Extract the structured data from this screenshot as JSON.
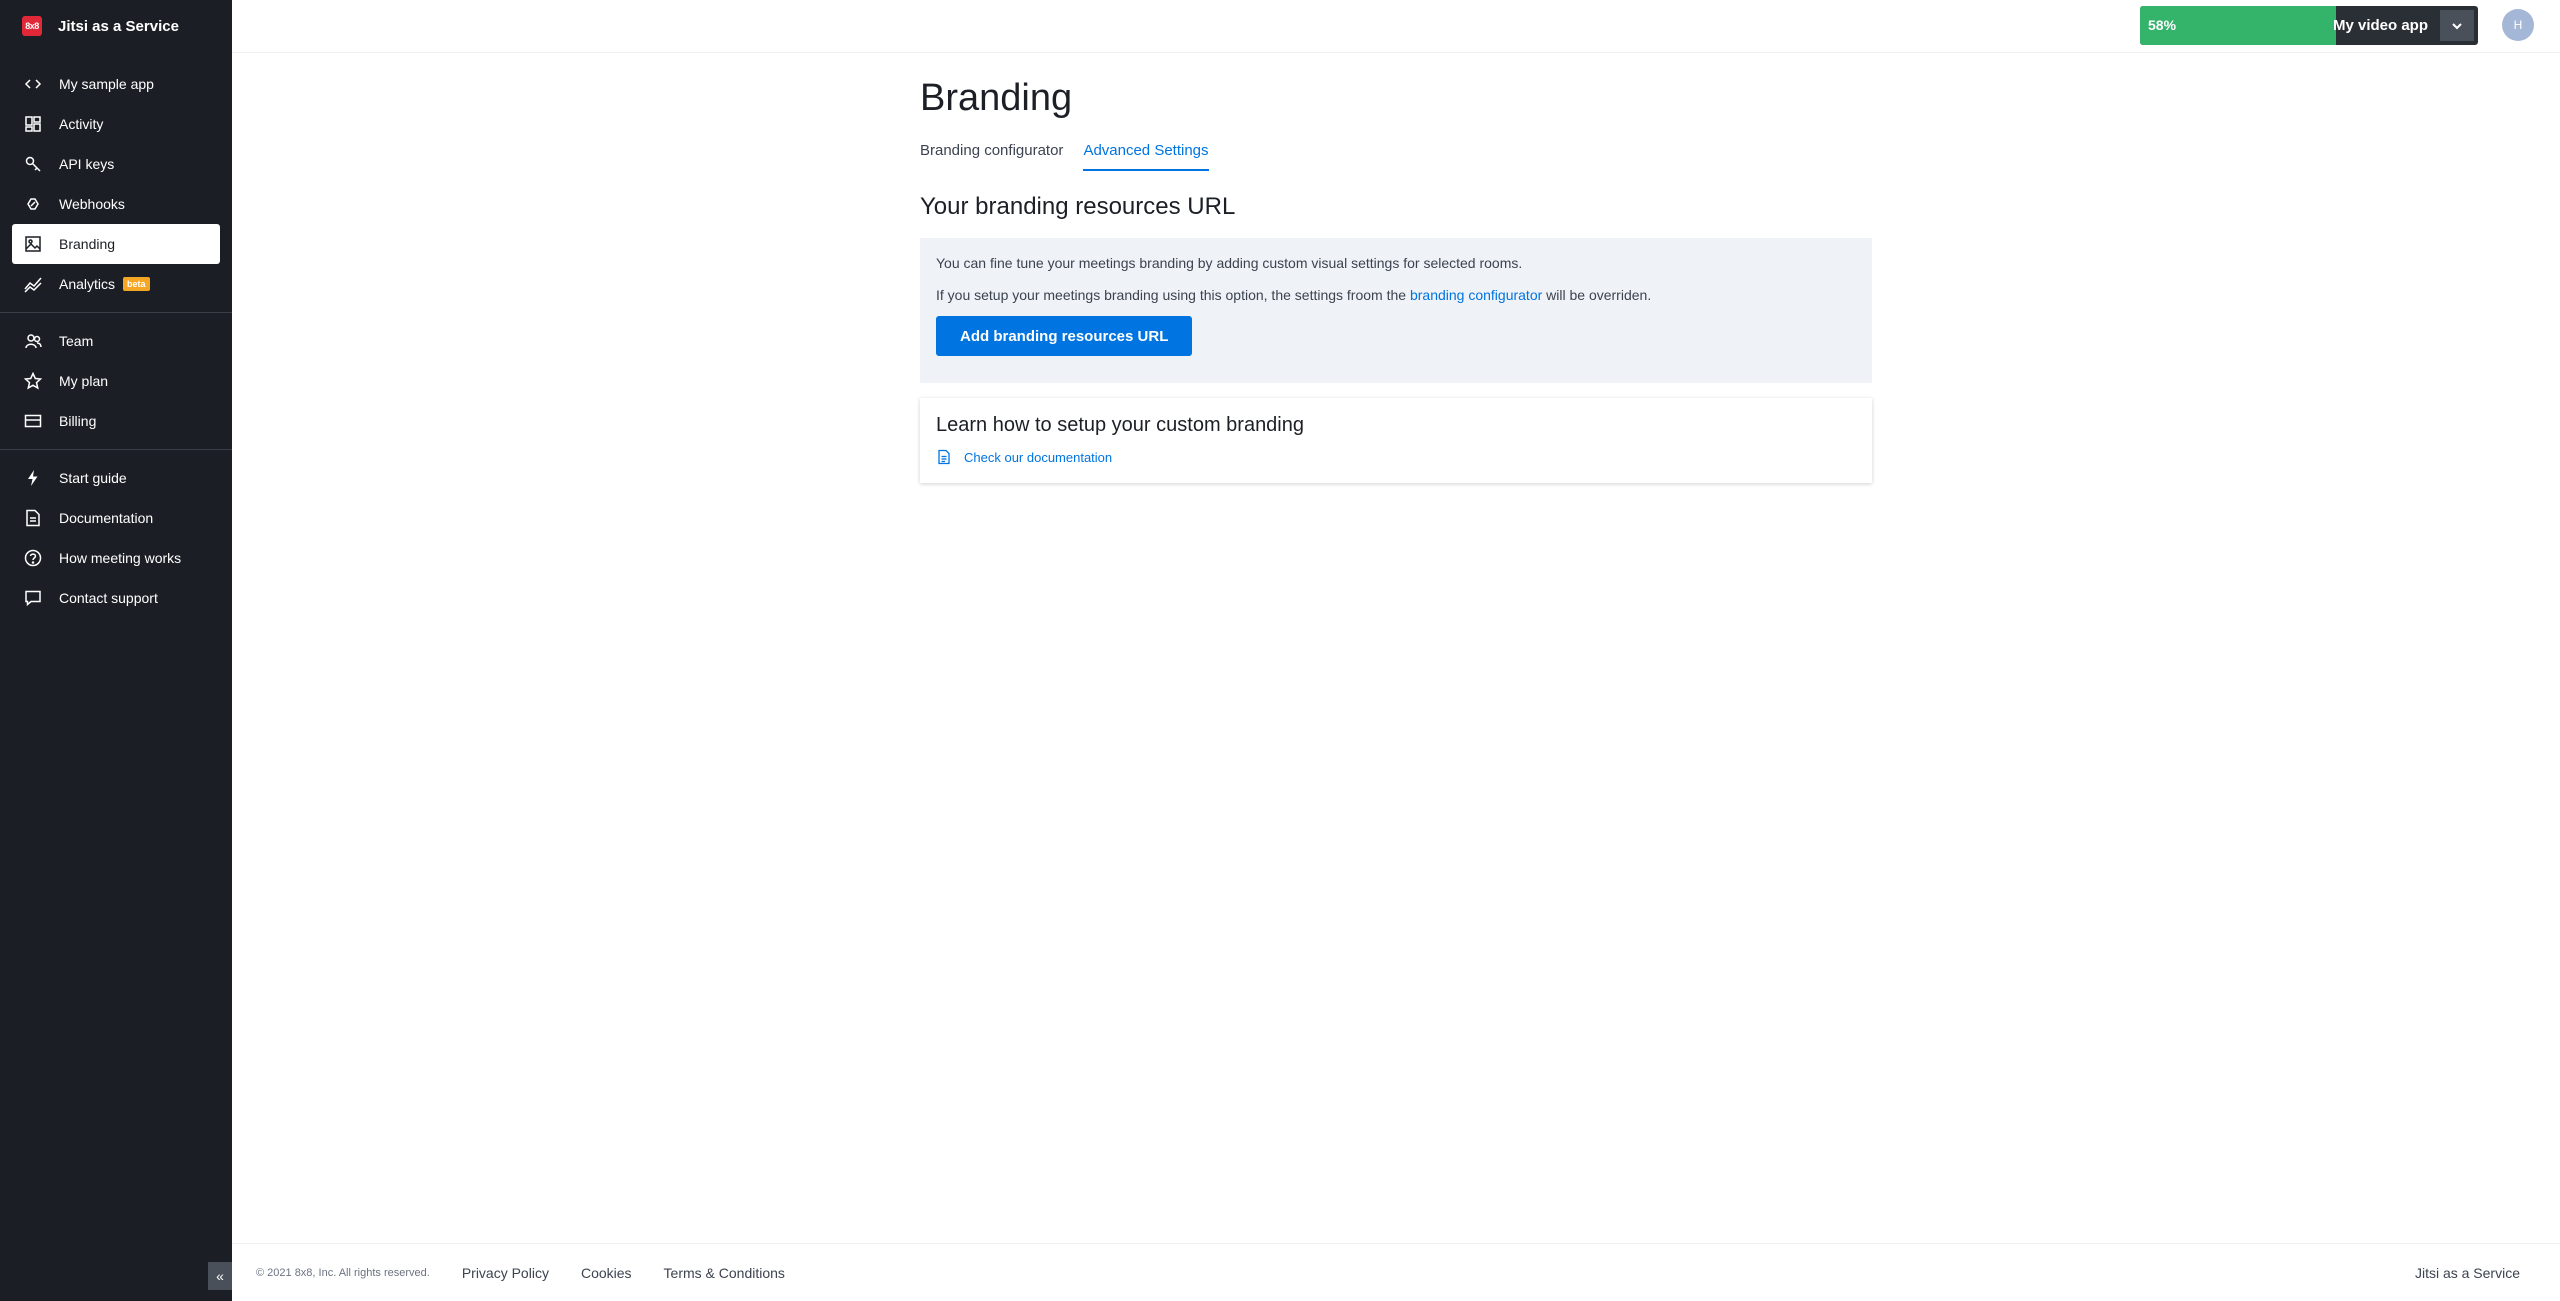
{
  "app": {
    "logo_text": "8x8",
    "name": "Jitsi as a Service"
  },
  "sidebar": {
    "groups": [
      [
        {
          "label": "My sample app",
          "icon": "code-icon"
        },
        {
          "label": "Activity",
          "icon": "dashboard-icon"
        },
        {
          "label": "API keys",
          "icon": "key-icon"
        },
        {
          "label": "Webhooks",
          "icon": "webhook-icon"
        },
        {
          "label": "Branding",
          "icon": "image-icon",
          "active": true
        },
        {
          "label": "Analytics",
          "icon": "chart-icon",
          "badge": "beta"
        }
      ],
      [
        {
          "label": "Team",
          "icon": "team-icon"
        },
        {
          "label": "My plan",
          "icon": "star-icon"
        },
        {
          "label": "Billing",
          "icon": "card-icon"
        }
      ],
      [
        {
          "label": "Start guide",
          "icon": "bolt-icon"
        },
        {
          "label": "Documentation",
          "icon": "doc-icon"
        },
        {
          "label": "How meeting works",
          "icon": "help-icon"
        },
        {
          "label": "Contact support",
          "icon": "chat-icon"
        }
      ]
    ],
    "collapse_icon": "double-chevron-left-icon"
  },
  "topbar": {
    "progress_label": "58%",
    "progress_value": 58,
    "app_selector_label": "My video app",
    "avatar_initial": "H",
    "colors": {
      "progress": "#34b36b",
      "selector_bg": "#2a2f36"
    }
  },
  "main": {
    "title": "Branding",
    "tabs": [
      {
        "label": "Branding configurator",
        "active": false
      },
      {
        "label": "Advanced Settings",
        "active": true
      }
    ],
    "section_title": "Your branding resources URL",
    "info": {
      "line1": "You can fine tune your meetings branding by adding custom visual settings for selected rooms.",
      "line2_prefix": "If you setup your meetings branding using this option, the settings froom the ",
      "line2_link": "branding configurator",
      "line2_suffix": " will be overriden.",
      "button_label": "Add branding resources URL"
    },
    "card": {
      "title": "Learn how to setup your custom branding",
      "link": "Check our documentation"
    }
  },
  "footer": {
    "copyright": "© 2021 8x8, Inc. All rights reserved.",
    "links": [
      "Privacy Policy",
      "Cookies",
      "Terms & Conditions"
    ],
    "right_text": "Jitsi as a Service"
  },
  "colors": {
    "accent": "#0074e0",
    "sidebar_bg": "#1b1f25",
    "info_bg": "#eff2f6",
    "brand_red": "#e02839"
  }
}
